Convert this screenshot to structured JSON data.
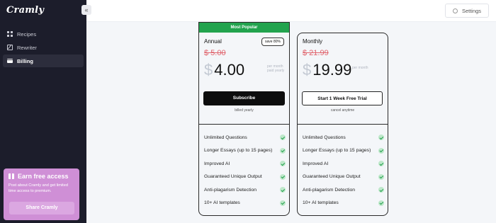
{
  "app": {
    "logo": "Cramly",
    "collapse_glyph": "«"
  },
  "sidebar": {
    "items": [
      {
        "label": "Recipes",
        "icon": "grid-icon",
        "active": false
      },
      {
        "label": "Rewriter",
        "icon": "pen-icon",
        "active": false
      },
      {
        "label": "Billing",
        "icon": "credit-card-icon",
        "active": true
      }
    ],
    "promo": {
      "title": "Earn free access",
      "text": "Post about Cramly and get limited time access to premium.",
      "button": "Share Cramly",
      "color": "#cf8fd6"
    }
  },
  "topbar": {
    "settings_label": "Settings"
  },
  "plans": {
    "annual": {
      "ribbon": "Most Popular",
      "name": "Annual",
      "badge": "save 80%",
      "old_price": "$ 5.00",
      "currency": "$",
      "price": "4.00",
      "note_line1": "per month",
      "note_line2": "paid yearly",
      "button": "Subscribe",
      "billing_note": "billed yearly"
    },
    "monthly": {
      "name": "Monthly",
      "old_price": "$ 21.99",
      "currency": "$",
      "price": "19.99",
      "note_line1": "per month",
      "button": "Start 1 Week Free Trial",
      "billing_note": "cancel anytime"
    },
    "features": [
      "Unlimited Questions",
      "Longer Essays (up to 15 pages)",
      "Improved AI",
      "Guaranteed Unique Output",
      "Anti-plagarism Detection",
      "10+ AI templates"
    ]
  },
  "colors": {
    "accent_green": "#22a34e",
    "strike_red": "#e0646d",
    "sidebar_bg": "#1c1d2b"
  }
}
